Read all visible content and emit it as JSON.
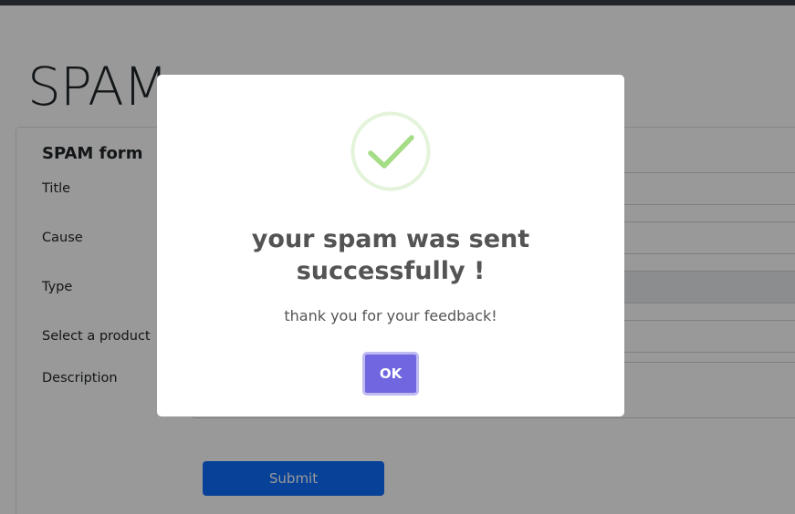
{
  "page": {
    "title": "SPAM"
  },
  "form": {
    "heading": "SPAM form",
    "fields": [
      {
        "label": "Title",
        "value": ""
      },
      {
        "label": "Cause",
        "value": ""
      },
      {
        "label": "Type",
        "value": ""
      },
      {
        "label": "Select a product",
        "value": ""
      },
      {
        "label": "Description",
        "value": ""
      }
    ],
    "submit_label": "Submit"
  },
  "modal": {
    "icon": "success-check-icon",
    "title": "your spam was sent successfully !",
    "text": "thank you for your feedback!",
    "ok_label": "OK"
  },
  "colors": {
    "primary": "#0d6efd",
    "confirm": "#7066e0",
    "success": "#a5dc86"
  }
}
